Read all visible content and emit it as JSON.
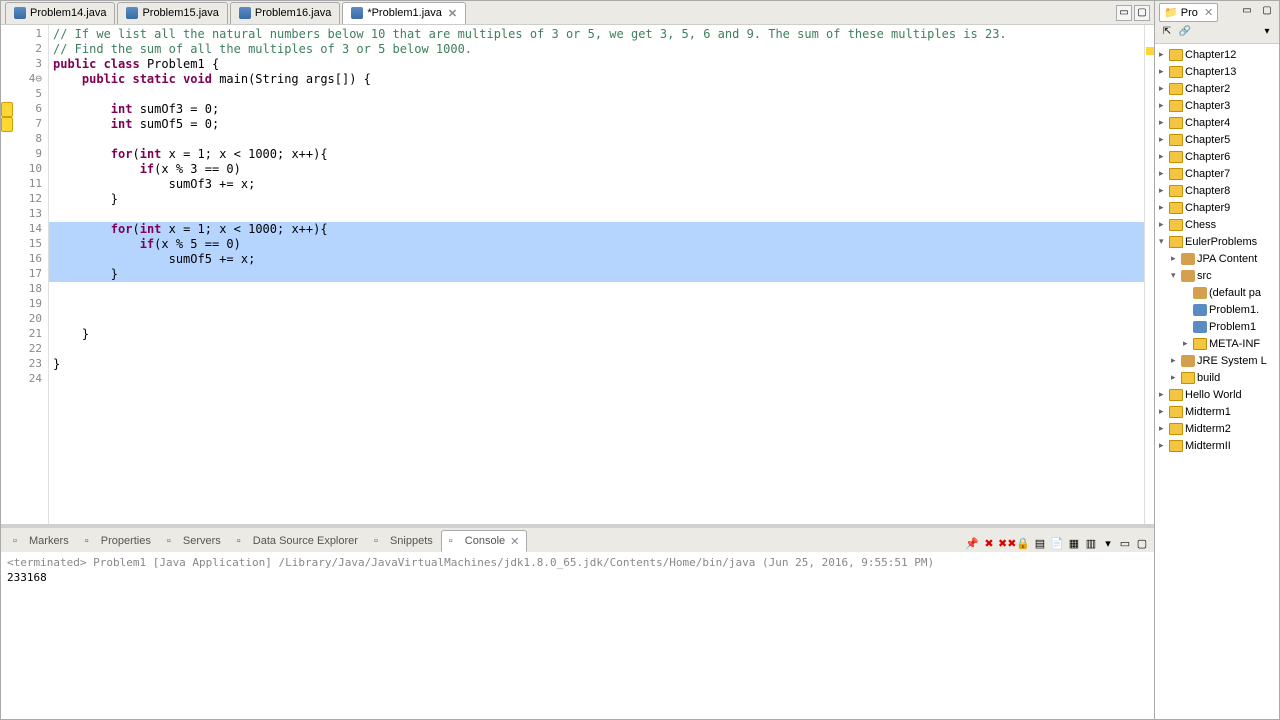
{
  "tabs": [
    {
      "label": "Problem14.java",
      "dirty": false
    },
    {
      "label": "Problem15.java",
      "dirty": false
    },
    {
      "label": "Problem16.java",
      "dirty": false
    },
    {
      "label": "*Problem1.java",
      "dirty": true,
      "active": true
    }
  ],
  "code": {
    "lines": [
      {
        "n": 1,
        "cls": "comment",
        "text": "// If we list all the natural numbers below 10 that are multiples of 3 or 5, we get 3, 5, 6 and 9. The sum of these multiples is 23."
      },
      {
        "n": 2,
        "cls": "comment",
        "text": "// Find the sum of all the multiples of 3 or 5 below 1000."
      },
      {
        "n": 3,
        "tokens": [
          [
            "keyword",
            "public "
          ],
          [
            "keyword",
            "class "
          ],
          [
            "plain",
            "Problem1 {"
          ]
        ]
      },
      {
        "n": 4,
        "foldable": true,
        "tokens": [
          [
            "plain",
            "    "
          ],
          [
            "keyword",
            "public "
          ],
          [
            "keyword",
            "static "
          ],
          [
            "keyword",
            "void "
          ],
          [
            "plain",
            "main(String args[]) {"
          ]
        ]
      },
      {
        "n": 5,
        "text": ""
      },
      {
        "n": 6,
        "marker": "warn",
        "tokens": [
          [
            "plain",
            "        "
          ],
          [
            "keyword",
            "int "
          ],
          [
            "plain",
            "sumOf3 = 0;"
          ]
        ]
      },
      {
        "n": 7,
        "marker": "warn",
        "tokens": [
          [
            "plain",
            "        "
          ],
          [
            "keyword",
            "int "
          ],
          [
            "plain",
            "sumOf5 = 0;"
          ]
        ]
      },
      {
        "n": 8,
        "text": ""
      },
      {
        "n": 9,
        "tokens": [
          [
            "plain",
            "        "
          ],
          [
            "keyword",
            "for"
          ],
          [
            "plain",
            "("
          ],
          [
            "keyword",
            "int "
          ],
          [
            "plain",
            "x = 1; x < 1000; x++){"
          ]
        ]
      },
      {
        "n": 10,
        "tokens": [
          [
            "plain",
            "            "
          ],
          [
            "keyword",
            "if"
          ],
          [
            "plain",
            "(x % 3 == 0)"
          ]
        ]
      },
      {
        "n": 11,
        "text": "                sumOf3 += x;"
      },
      {
        "n": 12,
        "text": "        }"
      },
      {
        "n": 13,
        "text": ""
      },
      {
        "n": 14,
        "selected": true,
        "tokens": [
          [
            "plain",
            "        "
          ],
          [
            "keyword",
            "for"
          ],
          [
            "plain",
            "("
          ],
          [
            "keyword",
            "int "
          ],
          [
            "plain",
            "x = 1; x < 1000; x++){"
          ]
        ]
      },
      {
        "n": 15,
        "selected": true,
        "tokens": [
          [
            "plain",
            "            "
          ],
          [
            "keyword",
            "if"
          ],
          [
            "plain",
            "(x % 5 == 0)"
          ]
        ]
      },
      {
        "n": 16,
        "selected": true,
        "text": "                sumOf5 += x;"
      },
      {
        "n": 17,
        "selected": true,
        "text": "        }"
      },
      {
        "n": 18,
        "text": ""
      },
      {
        "n": 19,
        "text": ""
      },
      {
        "n": 20,
        "text": ""
      },
      {
        "n": 21,
        "text": "    }"
      },
      {
        "n": 22,
        "text": ""
      },
      {
        "n": 23,
        "text": "}"
      },
      {
        "n": 24,
        "text": ""
      }
    ]
  },
  "bottom_tabs": [
    {
      "label": "Markers"
    },
    {
      "label": "Properties"
    },
    {
      "label": "Servers"
    },
    {
      "label": "Data Source Explorer"
    },
    {
      "label": "Snippets"
    },
    {
      "label": "Console",
      "active": true,
      "close": true
    }
  ],
  "console": {
    "header": "<terminated> Problem1 [Java Application] /Library/Java/JavaVirtualMachines/jdk1.8.0_65.jdk/Contents/Home/bin/java (Jun 25, 2016, 9:55:51 PM)",
    "output": "233168"
  },
  "project_panel": {
    "title": "Pro",
    "tree": [
      {
        "depth": 0,
        "arrow": "▸",
        "ico": "folder",
        "label": "Chapter12"
      },
      {
        "depth": 0,
        "arrow": "▸",
        "ico": "folder",
        "label": "Chapter13"
      },
      {
        "depth": 0,
        "arrow": "▸",
        "ico": "folder",
        "label": "Chapter2"
      },
      {
        "depth": 0,
        "arrow": "▸",
        "ico": "folder",
        "label": "Chapter3"
      },
      {
        "depth": 0,
        "arrow": "▸",
        "ico": "folder",
        "label": "Chapter4"
      },
      {
        "depth": 0,
        "arrow": "▸",
        "ico": "folder",
        "label": "Chapter5"
      },
      {
        "depth": 0,
        "arrow": "▸",
        "ico": "folder",
        "label": "Chapter6"
      },
      {
        "depth": 0,
        "arrow": "▸",
        "ico": "folder",
        "label": "Chapter7"
      },
      {
        "depth": 0,
        "arrow": "▸",
        "ico": "folder",
        "label": "Chapter8"
      },
      {
        "depth": 0,
        "arrow": "▸",
        "ico": "folder",
        "label": "Chapter9"
      },
      {
        "depth": 0,
        "arrow": "▸",
        "ico": "folder",
        "label": "Chess"
      },
      {
        "depth": 0,
        "arrow": "▾",
        "ico": "folder",
        "label": "EulerProblems"
      },
      {
        "depth": 1,
        "arrow": "▸",
        "ico": "pkg",
        "label": "JPA Content"
      },
      {
        "depth": 1,
        "arrow": "▾",
        "ico": "pkg",
        "label": "src"
      },
      {
        "depth": 2,
        "arrow": " ",
        "ico": "pkg",
        "label": "(default pa"
      },
      {
        "depth": 2,
        "arrow": " ",
        "ico": "java",
        "label": "Problem1."
      },
      {
        "depth": 2,
        "arrow": " ",
        "ico": "java",
        "label": "Problem1"
      },
      {
        "depth": 2,
        "arrow": "▸",
        "ico": "folder",
        "label": "META-INF"
      },
      {
        "depth": 1,
        "arrow": "▸",
        "ico": "pkg",
        "label": "JRE System L"
      },
      {
        "depth": 1,
        "arrow": "▸",
        "ico": "folder",
        "label": "build"
      },
      {
        "depth": 0,
        "arrow": "▸",
        "ico": "folder",
        "label": "Hello World"
      },
      {
        "depth": 0,
        "arrow": "▸",
        "ico": "folder",
        "label": "Midterm1"
      },
      {
        "depth": 0,
        "arrow": "▸",
        "ico": "folder",
        "label": "Midterm2"
      },
      {
        "depth": 0,
        "arrow": "▸",
        "ico": "folder",
        "label": "MidtermII"
      }
    ]
  }
}
